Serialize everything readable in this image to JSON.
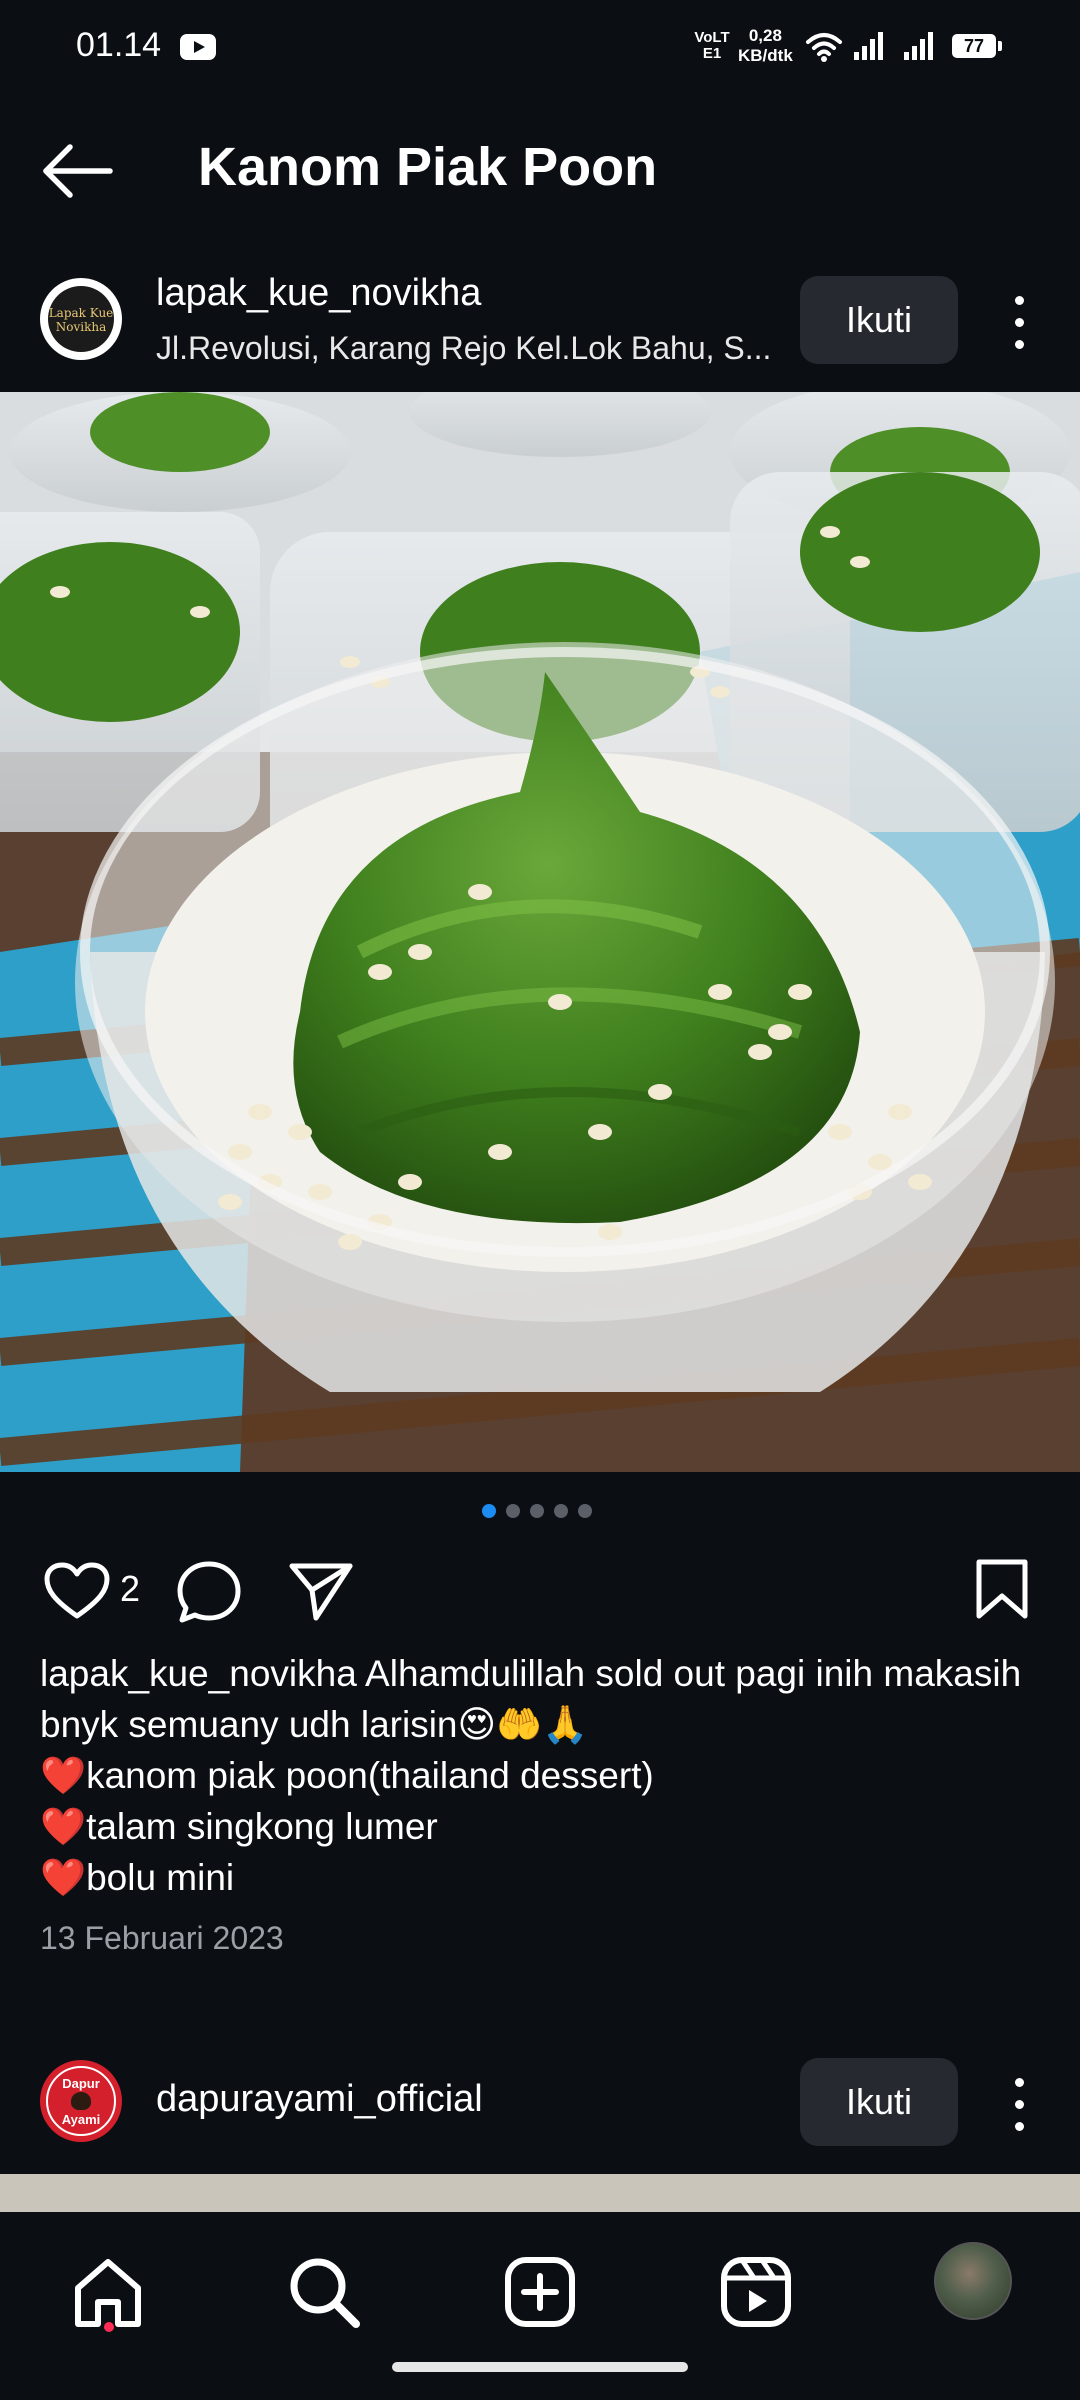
{
  "status_bar": {
    "time": "01.14",
    "network_type": "VoLTE1",
    "net_speed_value": "0,28",
    "net_speed_unit": "KB/dtk",
    "battery": "77"
  },
  "header": {
    "title": "Kanom Piak Poon"
  },
  "post1": {
    "username": "lapak_kue_novikha",
    "location": "Jl.Revolusi, Karang Rejo Kel.Lok Bahu, S...",
    "follow_label": "Ikuti",
    "avatar_text": "Lapak Kue Novikha",
    "likes": "2",
    "carousel_total": 5,
    "carousel_active": 1,
    "caption_username": "lapak_kue_novikha",
    "caption_text": "Alhamdulillah sold out pagi inih makasih bnyk semuany udh larisin😍🤲🙏",
    "caption_items": [
      "kanom piak poon(thailand dessert)",
      "talam singkong lumer",
      "bolu mini"
    ],
    "bullet": "❤️",
    "date": "13 Februari 2023"
  },
  "post2": {
    "username": "dapurayami_official",
    "follow_label": "Ikuti",
    "avatar_text_top": "Dapur",
    "avatar_text_bottom": "Ayami"
  },
  "icons": {
    "back": "arrow-left-icon",
    "more": "more-vertical-icon",
    "like": "heart-icon",
    "comment": "comment-icon",
    "share": "send-icon",
    "save": "bookmark-icon",
    "home": "home-icon",
    "search": "search-icon",
    "create": "plus-square-icon",
    "reels": "reels-icon"
  },
  "colors": {
    "background": "#0b0f14",
    "follow_button": "#262a30",
    "carousel_active": "#1d8cf2",
    "notification_dot": "#ff2d55"
  }
}
